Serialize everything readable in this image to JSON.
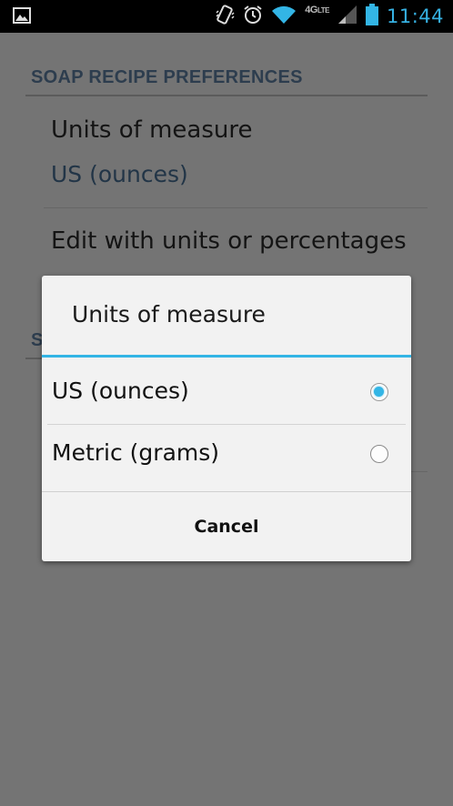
{
  "status_bar": {
    "network_type": "4G",
    "lte_label": "LTE",
    "time": "11:44",
    "icons": [
      "image-notification-icon",
      "vibrate-icon",
      "alarm-icon",
      "wifi-icon",
      "signal-icon",
      "battery-icon"
    ],
    "accent_color": "#33b5e5"
  },
  "settings": {
    "section_header": "SOAP RECIPE PREFERENCES",
    "items": [
      {
        "title": "Units of measure",
        "summary": "US (ounces)"
      },
      {
        "title": "Edit with units or percentages"
      }
    ],
    "next_section_peek": "S"
  },
  "dialog": {
    "title": "Units of measure",
    "options": [
      {
        "label": "US (ounces)",
        "selected": true
      },
      {
        "label": "Metric (grams)",
        "selected": false
      }
    ],
    "cancel_label": "Cancel"
  }
}
